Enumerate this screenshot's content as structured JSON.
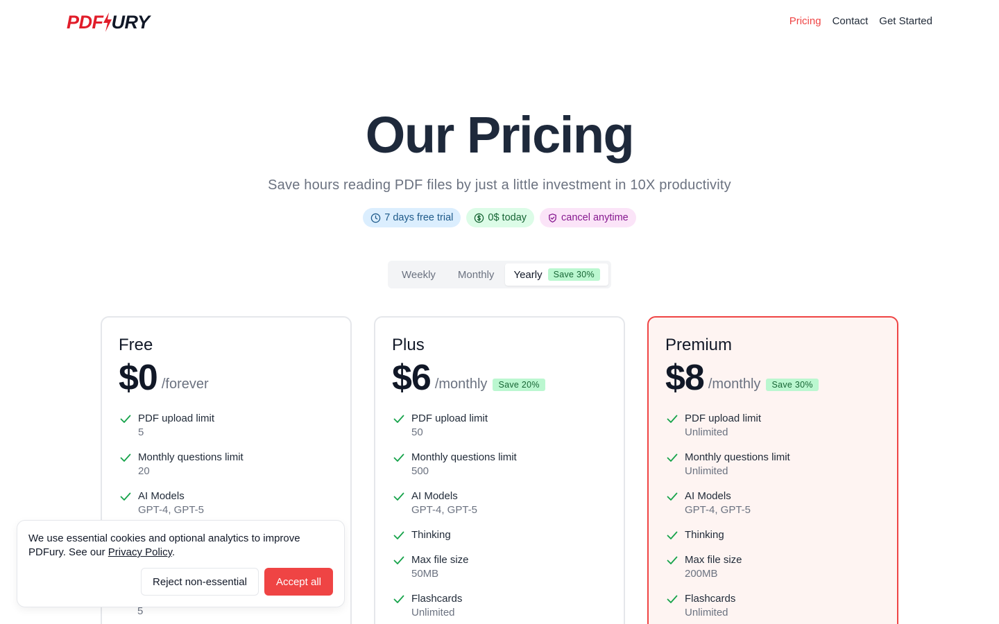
{
  "header": {
    "logo_part1": "PDF",
    "logo_part2": "URY",
    "nav": [
      "Pricing",
      "Contact",
      "Get Started"
    ],
    "active_nav": "Pricing",
    "brand_color": "#e11d2a"
  },
  "hero": {
    "title": "Our Pricing",
    "subtitle": "Save hours reading PDF files by just a little investment in 10X productivity",
    "badges": [
      {
        "icon": "clock-icon",
        "label": "7 days free trial"
      },
      {
        "icon": "dollar-circle-icon",
        "label": "0$ today"
      },
      {
        "icon": "shield-check-icon",
        "label": "cancel anytime"
      }
    ]
  },
  "billing_toggle": {
    "options": [
      "Weekly",
      "Monthly",
      "Yearly"
    ],
    "selected": "Yearly",
    "yearly_badge": "Save 30%"
  },
  "plans": [
    {
      "name": "Free",
      "price": "$0",
      "period": "/forever",
      "features": [
        {
          "label": "PDF upload limit",
          "value": "5"
        },
        {
          "label": "Monthly questions limit",
          "value": "20"
        },
        {
          "label": "AI Models",
          "value": "GPT-4, GPT-5"
        }
      ],
      "partial_value": "5"
    },
    {
      "name": "Plus",
      "price": "$6",
      "period": "/monthly",
      "save": "Save 20%",
      "features": [
        {
          "label": "PDF upload limit",
          "value": "50"
        },
        {
          "label": "Monthly questions limit",
          "value": "500"
        },
        {
          "label": "AI Models",
          "value": "GPT-4, GPT-5"
        },
        {
          "label": "Thinking",
          "value": ""
        },
        {
          "label": "Max file size",
          "value": "50MB"
        },
        {
          "label": "Flashcards",
          "value": "Unlimited"
        }
      ]
    },
    {
      "name": "Premium",
      "price": "$8",
      "period": "/monthly",
      "save": "Save 30%",
      "features": [
        {
          "label": "PDF upload limit",
          "value": "Unlimited"
        },
        {
          "label": "Monthly questions limit",
          "value": "Unlimited"
        },
        {
          "label": "AI Models",
          "value": "GPT-4, GPT-5"
        },
        {
          "label": "Thinking",
          "value": ""
        },
        {
          "label": "Max file size",
          "value": "200MB"
        },
        {
          "label": "Flashcards",
          "value": "Unlimited"
        }
      ]
    }
  ],
  "cookie": {
    "text": "We use essential cookies and optional analytics to improve PDFury. See our ",
    "link": "Privacy Policy",
    "end": ".",
    "reject": "Reject non-essential",
    "accept": "Accept all"
  }
}
